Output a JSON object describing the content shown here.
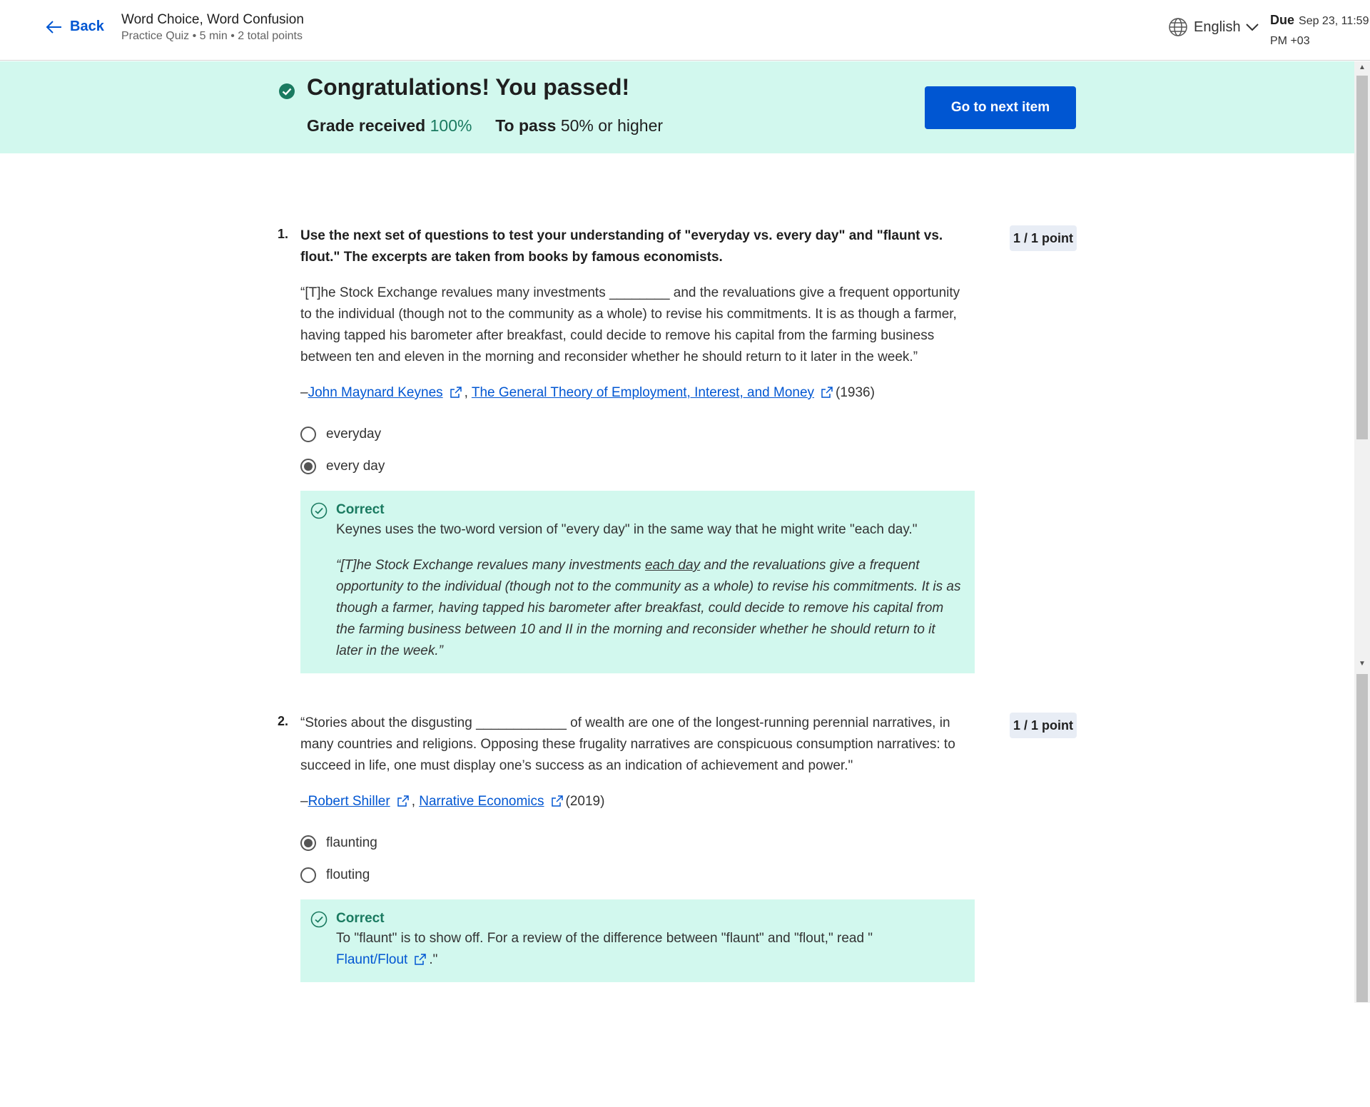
{
  "header": {
    "back_label": "Back",
    "title": "Word Choice, Word Confusion",
    "subtitle": "Practice Quiz • 5 min • 2 total points",
    "language": "English",
    "due_label": "Due",
    "due_date_line1": "Sep 23, 11:59",
    "due_date_line2": "PM +03"
  },
  "banner": {
    "message": "Congratulations! You passed!",
    "grade_label": "Grade received",
    "grade_value": "100%",
    "pass_label": "To pass",
    "pass_value": "50%",
    "pass_suffix": "or higher",
    "next_button": "Go to next item",
    "colors": {
      "banner_bg": "#d2f8ee",
      "accent": "#0056d2",
      "success": "#1a7a60"
    }
  },
  "questions": [
    {
      "number": "1.",
      "points": "1 / 1 point",
      "prompt_bold": "Use the next set of questions to test your understanding of \"everyday vs. every day\" and \"flaunt vs. flout.\" The excerpts are taken from books by  famous economists.",
      "excerpt": "“[T]he Stock Exchange revalues many investments ________ and the revaluations give a frequent opportunity to the individual (though not to the community as a whole) to revise his commitments. It is as though a farmer, having tapped his barometer after breakfast, could decide to remove his capital from the farming business between ten and eleven in the morning and reconsider whether he should return to it later in the week.”",
      "citation_dash": "–",
      "author": "John Maynard Keynes",
      "comma": ",",
      "book": "The General Theory of Employment, Interest, and Money",
      "year": "(1936)",
      "options": [
        {
          "label": "everyday",
          "selected": false
        },
        {
          "label": "every day",
          "selected": true
        }
      ],
      "feedback": {
        "title": "Correct",
        "text": "Keynes uses the two-word version of \"every day\" in the same way that he might write \"each day.\"",
        "quote_before": " “[T]he Stock Exchange revalues many investments ",
        "quote_underlined": "each day",
        "quote_after": " and the revaluations give a frequent opportunity to the individual (though not to the community as a whole) to revise his commitments. It is as though a farmer, having tapped his barometer after breakfast, could decide to remove his capital from the farming business between 10 and II in the morning and reconsider whether he should return to it later in the week.”"
      }
    },
    {
      "number": "2.",
      "points": "1 / 1 point",
      "excerpt": "“Stories about the disgusting ____________ of wealth are one of the longest-running perennial narratives, in many countries and religions. Opposing these frugality narratives are conspicuous consumption narratives: to succeed in life, one must display one’s success as an indication of achievement and power.\"",
      "citation_dash": "–",
      "author": "Robert Shiller",
      "comma": ",",
      "book": "Narrative Economics",
      "year": "(2019)",
      "options": [
        {
          "label": "flaunting",
          "selected": true
        },
        {
          "label": "flouting",
          "selected": false
        }
      ],
      "feedback": {
        "title": "Correct",
        "text": "To \"flaunt\" is to show off. For a review of the difference between \"flaunt\" and \"flout,\" read \"",
        "link": "Flaunt/Flout",
        "text_after": ".\""
      }
    }
  ]
}
